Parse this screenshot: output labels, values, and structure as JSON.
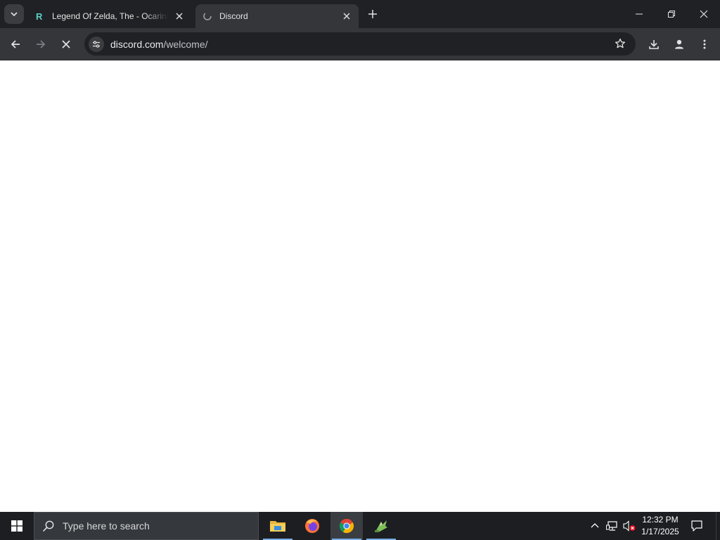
{
  "browser": {
    "tabs": [
      {
        "title": "Legend Of Zelda, The - Ocarina of Time",
        "favicon": "r-logo-icon",
        "active": false
      },
      {
        "title": "Discord",
        "favicon": "loading-spinner-icon",
        "active": true
      }
    ],
    "url": {
      "host": "discord.com",
      "path": "/welcome/"
    },
    "reload_state": "stop-loading-icon"
  },
  "taskbar": {
    "search_placeholder": "Type here to search",
    "apps": [
      "file-explorer-icon",
      "firefox-icon",
      "chrome-icon",
      "game-app-icon"
    ],
    "clock": {
      "time": "12:32 PM",
      "date": "1/17/2025"
    }
  },
  "colors": {
    "tabstrip": "#202124",
    "toolbar": "#35363a",
    "taskbar": "#1c1e22",
    "accent": "#79aee8"
  }
}
